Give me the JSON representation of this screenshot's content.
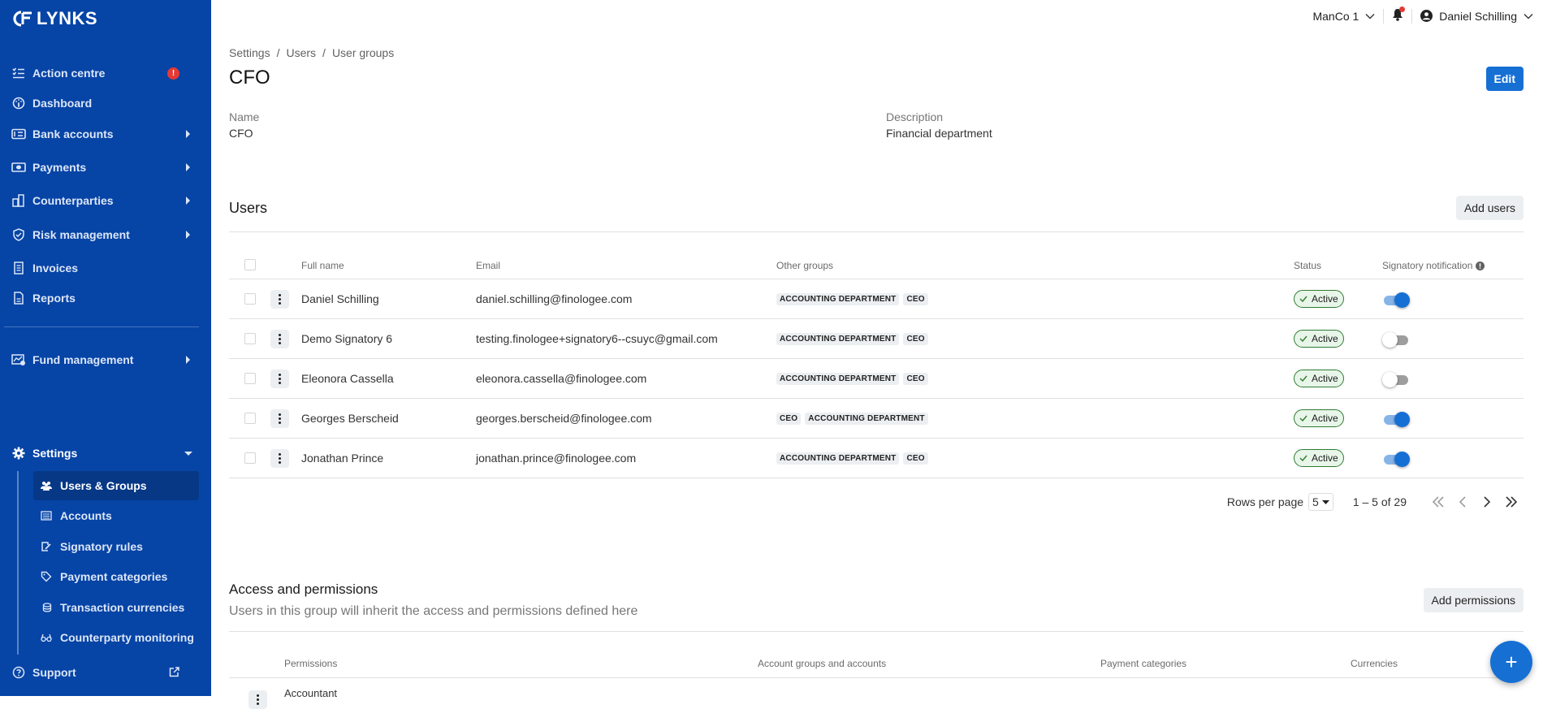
{
  "brand": {
    "name": "LYNKS"
  },
  "sidebar": {
    "items": [
      {
        "label": "Action centre",
        "icon": "checklist-icon",
        "badge": "!"
      },
      {
        "label": "Dashboard",
        "icon": "gauge-icon"
      },
      {
        "label": "Bank accounts",
        "icon": "bank-card-icon"
      },
      {
        "label": "Payments",
        "icon": "money-exchange-icon"
      },
      {
        "label": "Counterparties",
        "icon": "buildings-icon"
      },
      {
        "label": "Risk management",
        "icon": "shield-check-icon"
      },
      {
        "label": "Invoices",
        "icon": "receipt-icon"
      },
      {
        "label": "Reports",
        "icon": "document-icon"
      },
      {
        "label": "Fund management",
        "icon": "chart-fund-icon"
      },
      {
        "label": "Settings",
        "icon": "gear-icon"
      }
    ],
    "settings_sub": [
      {
        "label": "Users & Groups",
        "icon": "users-icon",
        "active": true
      },
      {
        "label": "Accounts",
        "icon": "list-card-icon"
      },
      {
        "label": "Signatory rules",
        "icon": "signature-icon"
      },
      {
        "label": "Payment categories",
        "icon": "tag-icon"
      },
      {
        "label": "Transaction currencies",
        "icon": "coins-icon"
      },
      {
        "label": "Counterparty monitoring",
        "icon": "glasses-icon"
      }
    ],
    "support": {
      "label": "Support",
      "icon": "help-circle-icon"
    }
  },
  "topbar": {
    "organization": "ManCo 1",
    "user_name": "Daniel Schilling"
  },
  "breadcrumb": [
    "Settings",
    "Users",
    "User groups"
  ],
  "page": {
    "title": "CFO",
    "edit_label": "Edit",
    "name_label": "Name",
    "name_value": "CFO",
    "description_label": "Description",
    "description_value": "Financial department"
  },
  "users_section": {
    "title": "Users",
    "add_label": "Add users",
    "columns": [
      "Full name",
      "Email",
      "Other groups",
      "Status",
      "Signatory notification"
    ],
    "rows": [
      {
        "name": "Daniel Schilling",
        "email": "daniel.schilling@finologee.com",
        "groups": [
          "ACCOUNTING DEPARTMENT",
          "CEO"
        ],
        "status": "Active",
        "notify": true
      },
      {
        "name": "Demo Signatory 6",
        "email": "testing.finologee+signatory6--csuyc@gmail.com",
        "groups": [
          "ACCOUNTING DEPARTMENT",
          "CEO"
        ],
        "status": "Active",
        "notify": false
      },
      {
        "name": "Eleonora Cassella",
        "email": "eleonora.cassella@finologee.com",
        "groups": [
          "ACCOUNTING DEPARTMENT",
          "CEO"
        ],
        "status": "Active",
        "notify": false
      },
      {
        "name": "Georges Berscheid",
        "email": "georges.berscheid@finologee.com",
        "groups": [
          "CEO",
          "ACCOUNTING DEPARTMENT"
        ],
        "status": "Active",
        "notify": true
      },
      {
        "name": "Jonathan Prince",
        "email": "jonathan.prince@finologee.com",
        "groups": [
          "ACCOUNTING DEPARTMENT",
          "CEO"
        ],
        "status": "Active",
        "notify": true
      }
    ],
    "pagination": {
      "rows_per_page_label": "Rows per page",
      "rows_per_page": "5",
      "range": "1 – 5 of 29"
    }
  },
  "permissions_section": {
    "title": "Access and permissions",
    "subtitle": "Users in this group will inherit the access and permissions defined here",
    "add_label": "Add permissions",
    "columns": [
      "Permissions",
      "Account groups and accounts",
      "Payment categories",
      "Currencies"
    ],
    "rows": [
      {
        "permission": "Accountant"
      }
    ]
  },
  "fab": {
    "label": "+"
  }
}
